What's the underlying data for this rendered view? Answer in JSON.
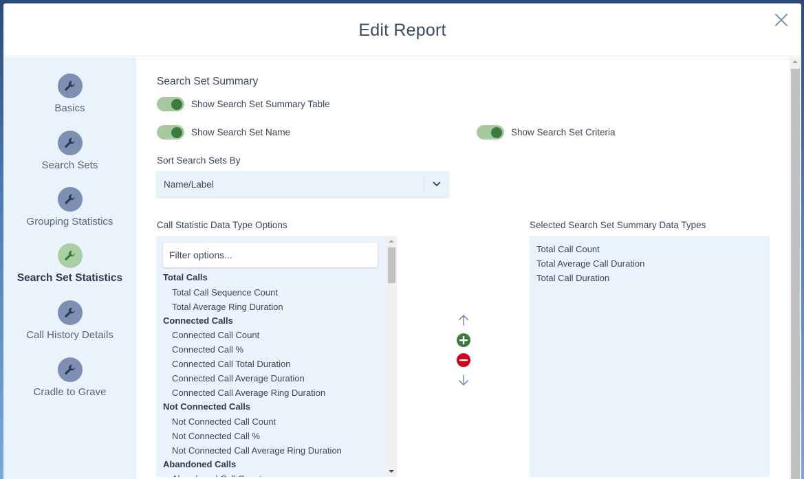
{
  "modal": {
    "title": "Edit Report"
  },
  "sidebar": {
    "items": [
      {
        "label": "Basics",
        "icon": "wrench-icon",
        "active": false
      },
      {
        "label": "Search Sets",
        "icon": "wrench-icon",
        "active": false
      },
      {
        "label": "Grouping Statistics",
        "icon": "wrench-icon",
        "active": false
      },
      {
        "label": "Search Set Statistics",
        "icon": "wrench-icon",
        "active": true
      },
      {
        "label": "Call History Details",
        "icon": "wrench-icon",
        "active": false
      },
      {
        "label": "Cradle to Grave",
        "icon": "wrench-icon",
        "active": false
      }
    ]
  },
  "main": {
    "section_title": "Search Set Summary",
    "toggles": {
      "show_summary_table": {
        "label": "Show Search Set Summary Table",
        "on": true
      },
      "show_name": {
        "label": "Show Search Set Name",
        "on": true
      },
      "show_criteria": {
        "label": "Show Search Set Criteria",
        "on": true
      }
    },
    "sort": {
      "label": "Sort Search Sets By",
      "value": "Name/Label"
    },
    "options": {
      "label": "Call Statistic Data Type Options",
      "filter_placeholder": "Filter options...",
      "groups": [
        {
          "name": "Total Calls",
          "items": [
            "Total Call Sequence Count",
            "Total Average Ring Duration"
          ]
        },
        {
          "name": "Connected Calls",
          "items": [
            "Connected Call Count",
            "Connected Call %",
            "Connected Call Total Duration",
            "Connected Call Average Duration",
            "Connected Call Average Ring Duration"
          ]
        },
        {
          "name": "Not Connected Calls",
          "items": [
            "Not Connected Call Count",
            "Not Connected Call %",
            "Not Connected Call Average Ring Duration"
          ]
        },
        {
          "name": "Abandoned Calls",
          "items": [
            "Abandoned Call Count"
          ]
        }
      ]
    },
    "selected": {
      "label": "Selected Search Set Summary Data Types",
      "items": [
        "Total Call Count",
        "Total Average Call Duration",
        "Total Call Duration"
      ]
    }
  },
  "colors": {
    "accent_green": "#3d7a3e",
    "toggle_track": "#a6c9a0",
    "remove_red": "#d0021b",
    "panel_bg": "#eaf2fc",
    "icon_blue": "#7d8fb3"
  }
}
